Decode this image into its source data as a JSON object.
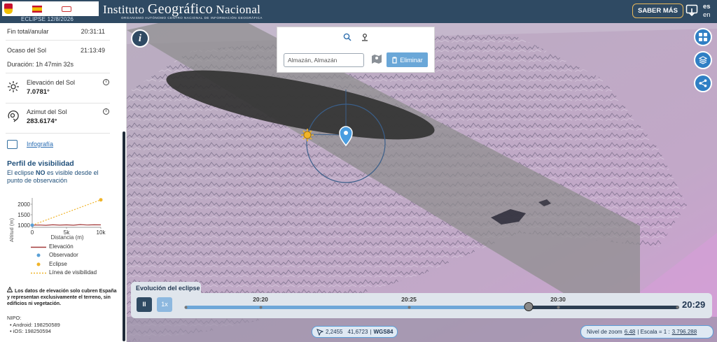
{
  "header": {
    "eclipse_tag": "ECLIPSE 12/8/2026",
    "title_pre": "Instituto ",
    "title_big": "Geográfico",
    "title_post": " Nacional",
    "subtitle": "ORGANISMO AUTÓNOMO CENTRO NACIONAL DE INFORMACIÓN GEOGRÁFICA",
    "saber_mas": "SABER MÁS",
    "lang_es": "es",
    "lang_en": "en"
  },
  "sidebar": {
    "fin_label": "Fin total/anular",
    "fin_value": "20:31:11",
    "ocaso_label": "Ocaso del Sol",
    "ocaso_value": "21:13:49",
    "duracion": "Duración: 1h 47min 32s",
    "elevacion_label": "Elevación del Sol",
    "elevacion_value": "7.0781°",
    "azimut_label": "Azimut del Sol",
    "azimut_value": "283.6174°",
    "infografia": "Infografía",
    "perfil_title": "Perfil de visibilidad",
    "perfil_text_1": "El eclipse ",
    "perfil_text_no": "NO",
    "perfil_text_2": " es visible desde el punto de observación",
    "warning": "Los datos de elevación solo cubren España y representan exclusivamente el terreno, sin edificios ni vegetación.",
    "nipo_title": "NIPO:",
    "nipo_android": "• Android: 198250589",
    "nipo_ios": "• iOS: 198250594"
  },
  "chart_data": {
    "type": "line",
    "xlabel": "Distancia (m)",
    "ylabel": "Altitud (m)",
    "x_ticks": [
      "0",
      "5k",
      "10k"
    ],
    "y_ticks": [
      "1000",
      "1500",
      "2000"
    ],
    "xlim": [
      0,
      10000
    ],
    "ylim": [
      900,
      2300
    ],
    "series": [
      {
        "name": "Elevación",
        "color": "#a33a3a",
        "x": [
          0,
          1000,
          2000,
          3000,
          4000,
          5000,
          6000,
          7000,
          8000,
          9000,
          10000
        ],
        "y": [
          1000,
          1010,
          995,
          1020,
          1005,
          1015,
          1000,
          1030,
          1010,
          1020,
          1015
        ]
      },
      {
        "name": "Línea de visibilidad",
        "color": "#f0b429",
        "x": [
          0,
          10000
        ],
        "y": [
          1000,
          2210
        ]
      }
    ],
    "points": [
      {
        "name": "Observador",
        "color": "#5aa0d6",
        "x": 0,
        "y": 1000
      },
      {
        "name": "Eclipse",
        "color": "#f0b429",
        "x": 10000,
        "y": 2210
      }
    ],
    "legend": [
      "Elevación",
      "Observador",
      "Eclipse",
      "Línea de visibilidad"
    ]
  },
  "search": {
    "value": "Almazán, Almazán",
    "eliminar": "Eliminar"
  },
  "timeline": {
    "tab": "Evolución del eclipse",
    "pause": "II",
    "speed": "1x",
    "ticks": [
      "20:20",
      "20:25",
      "20:30"
    ],
    "progress": 0.695,
    "current_time": "20:29"
  },
  "status": {
    "coords_x": "2,2455",
    "coords_y": "41,6723",
    "crs": "WGS84",
    "zoom_label": "Nivel de zoom",
    "zoom_value": "6.48",
    "scale_label": "Escala = 1 :",
    "scale_value": "3.796.288"
  }
}
